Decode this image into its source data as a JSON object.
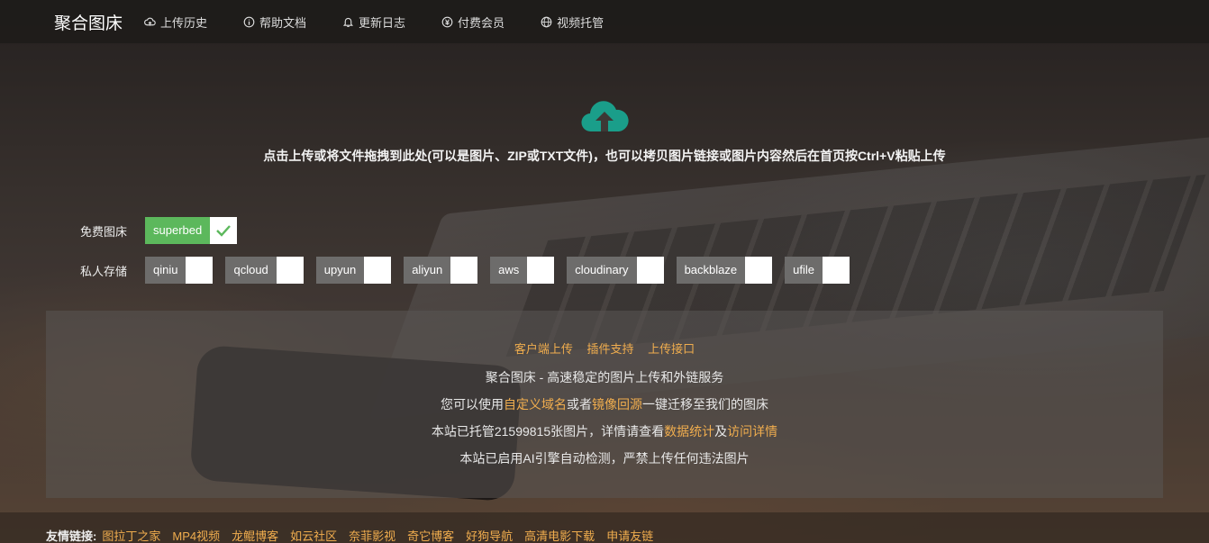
{
  "nav": {
    "brand": "聚合图床",
    "items": [
      {
        "label": "上传历史",
        "icon": "cloud-icon"
      },
      {
        "label": "帮助文档",
        "icon": "info-icon"
      },
      {
        "label": "更新日志",
        "icon": "bell-icon"
      },
      {
        "label": "付费会员",
        "icon": "yen-icon"
      },
      {
        "label": "视频托管",
        "icon": "globe-icon"
      }
    ]
  },
  "upload": {
    "icon": "cloud-upload-icon",
    "hint": "点击上传或将文件拖拽到此处(可以是图片、ZIP或TXT文件)，也可以拷贝图片链接或图片内容然后在首页按Ctrl+V粘贴上传"
  },
  "storage": {
    "free_label": "免费图床",
    "free_options": [
      {
        "name": "superbed",
        "checked": true
      }
    ],
    "private_label": "私人存储",
    "private_options": [
      {
        "name": "qiniu",
        "checked": false
      },
      {
        "name": "qcloud",
        "checked": false
      },
      {
        "name": "upyun",
        "checked": false
      },
      {
        "name": "aliyun",
        "checked": false
      },
      {
        "name": "aws",
        "checked": false
      },
      {
        "name": "cloudinary",
        "checked": false
      },
      {
        "name": "backblaze",
        "checked": false
      },
      {
        "name": "ufile",
        "checked": false
      }
    ]
  },
  "panel": {
    "links": [
      "客户端上传",
      "插件支持",
      "上传接口"
    ],
    "line1": "聚合图床 - 高速稳定的图片上传和外链服务",
    "line2": {
      "p1": "您可以使用",
      "link1": "自定义域名",
      "p2": "或者",
      "link2": "镜像回源",
      "p3": "一键迁移至我们的图床"
    },
    "line3": {
      "p1": "本站已托管21599815张图片，详情请查看",
      "link1": "数据统计",
      "p2": "及",
      "link2": "访问详情"
    },
    "line4": "本站已启用AI引擎自动检测，严禁上传任何违法图片"
  },
  "footer": {
    "label": "友情链接:",
    "links": [
      "图拉丁之家",
      "MP4视频",
      "龙鲲博客",
      "如云社区",
      "奈菲影视",
      "奇它博客",
      "好狗导航",
      "高清电影下载",
      "申请友链"
    ]
  },
  "colors": {
    "accent": "#f0ad4e",
    "checked": "#5cb85c",
    "upload_icon": "#1a9e8a"
  }
}
